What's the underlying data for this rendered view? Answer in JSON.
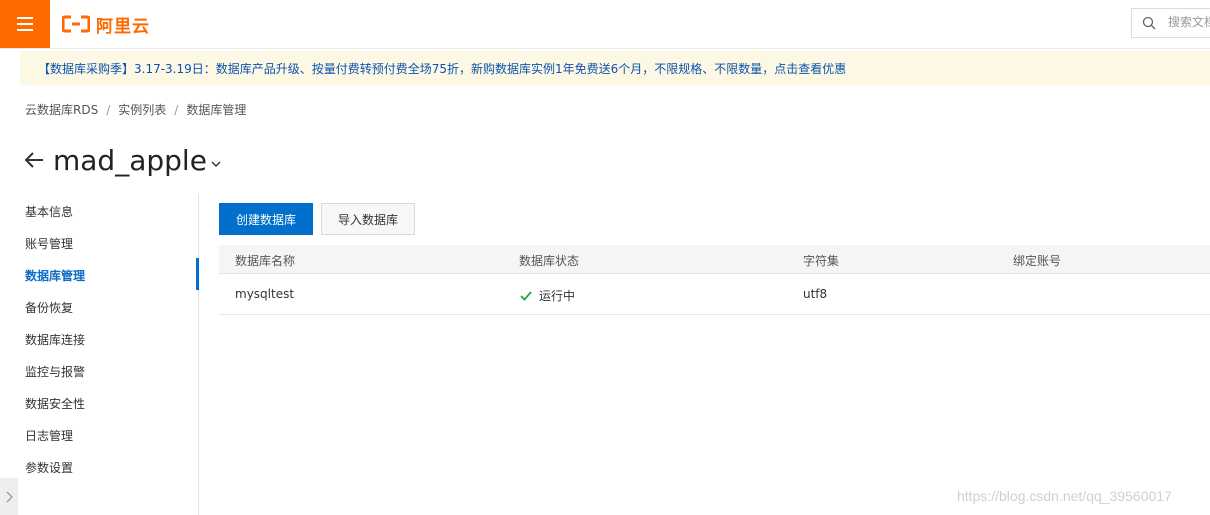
{
  "header": {
    "menu_icon": "hamburger-menu-icon",
    "logo_text": "阿里云",
    "search_placeholder": "搜索文档",
    "brand_color": "#ff6a00"
  },
  "notice": {
    "text": "【数据库采购季】3.17-3.19日：数据库产品升级、按量付费转预付费全场75折，新购数据库实例1年免费送6个月，不限规格、不限数量，点击查看优惠",
    "background": "#fdf8e3",
    "text_color": "#0d52b0"
  },
  "breadcrumb": {
    "items": [
      "云数据库RDS",
      "实例列表",
      "数据库管理"
    ],
    "separator": "/"
  },
  "page": {
    "title": "mad_apple"
  },
  "sidebar": {
    "items": [
      {
        "label": "基本信息"
      },
      {
        "label": "账号管理"
      },
      {
        "label": "数据库管理",
        "active": true
      },
      {
        "label": "备份恢复"
      },
      {
        "label": "数据库连接"
      },
      {
        "label": "监控与报警"
      },
      {
        "label": "数据安全性"
      },
      {
        "label": "日志管理"
      },
      {
        "label": "参数设置"
      }
    ],
    "active_color": "#0070cc"
  },
  "toolbar": {
    "create_label": "创建数据库",
    "import_label": "导入数据库"
  },
  "table": {
    "columns": [
      "数据库名称",
      "数据库状态",
      "字符集",
      "绑定账号"
    ],
    "rows": [
      {
        "name": "mysqltest",
        "status": "运行中",
        "charset": "utf8",
        "account": ""
      }
    ],
    "status_color": "#28a745"
  },
  "watermark": "https://blog.csdn.net/qq_39560017"
}
